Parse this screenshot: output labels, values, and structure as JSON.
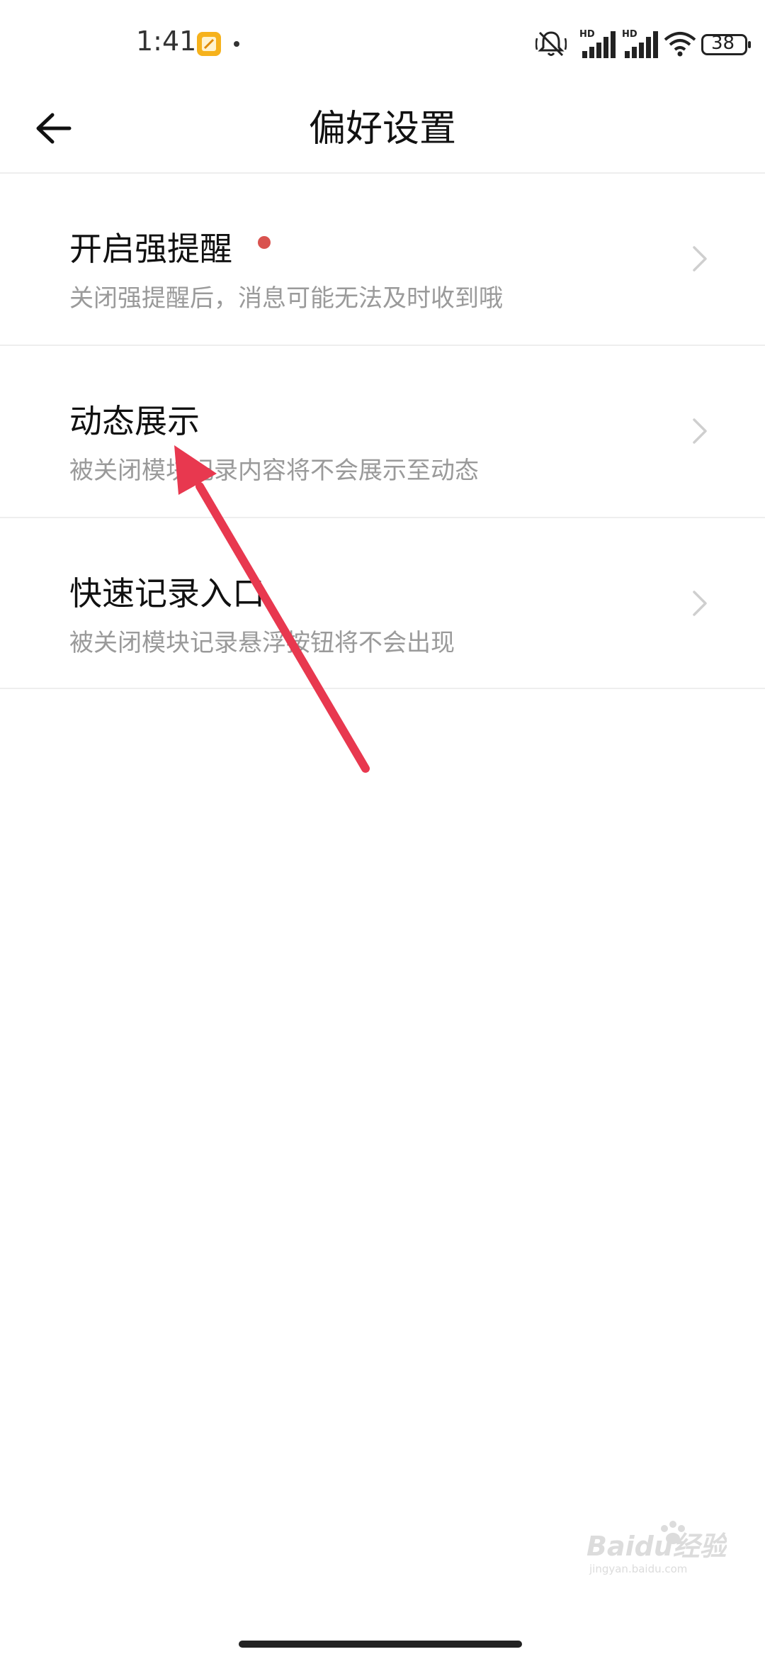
{
  "status_bar": {
    "time": "1:41",
    "app_icon": "notes-app-icon",
    "right_icons": [
      "bell-off-icon",
      "hd-signal-icon",
      "hd-signal-icon",
      "wifi-icon",
      "battery-icon"
    ],
    "hd_label": "HD",
    "battery": "38"
  },
  "header": {
    "title": "偏好设置",
    "back_icon": "arrow-left-icon"
  },
  "settings": [
    {
      "title": "开启强提醒",
      "description": "关闭强提醒后，消息可能无法及时收到哦",
      "has_dot": true
    },
    {
      "title": "动态展示",
      "description": "被关闭模块记录内容将不会展示至动态",
      "has_dot": false
    },
    {
      "title": "快速记录入口",
      "description": "被关闭模块记录悬浮按钮将不会出现",
      "has_dot": false
    }
  ],
  "watermark": {
    "text": "Baidu经验",
    "subtext": "jingyan.baidu.com"
  },
  "colors": {
    "accent_dot": "#d9534f",
    "annotation_arrow": "#e8384f",
    "divider": "#eeeeee",
    "secondary_text": "#9a9a9a"
  }
}
